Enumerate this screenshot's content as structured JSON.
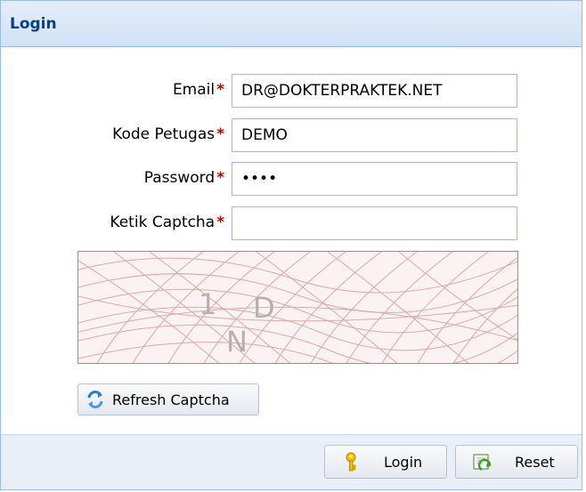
{
  "panel": {
    "title": "Login"
  },
  "form": {
    "email": {
      "label": "Email",
      "value": "DR@DOKTERPRAKTEK.NET"
    },
    "kode_petugas": {
      "label": "Kode Petugas",
      "value": "DEMO"
    },
    "password": {
      "label": "Password",
      "value": "abcd"
    },
    "captcha_input": {
      "label": "Ketik Captcha",
      "value": ""
    },
    "required_mark": "*"
  },
  "captcha": {
    "chars": [
      "1",
      "D",
      "N"
    ]
  },
  "buttons": {
    "refresh_captcha": "Refresh Captcha",
    "login": "Login",
    "reset": "Reset"
  },
  "colors": {
    "header_title": "#04408c",
    "required": "#cc0000",
    "border": "#99bce8"
  }
}
